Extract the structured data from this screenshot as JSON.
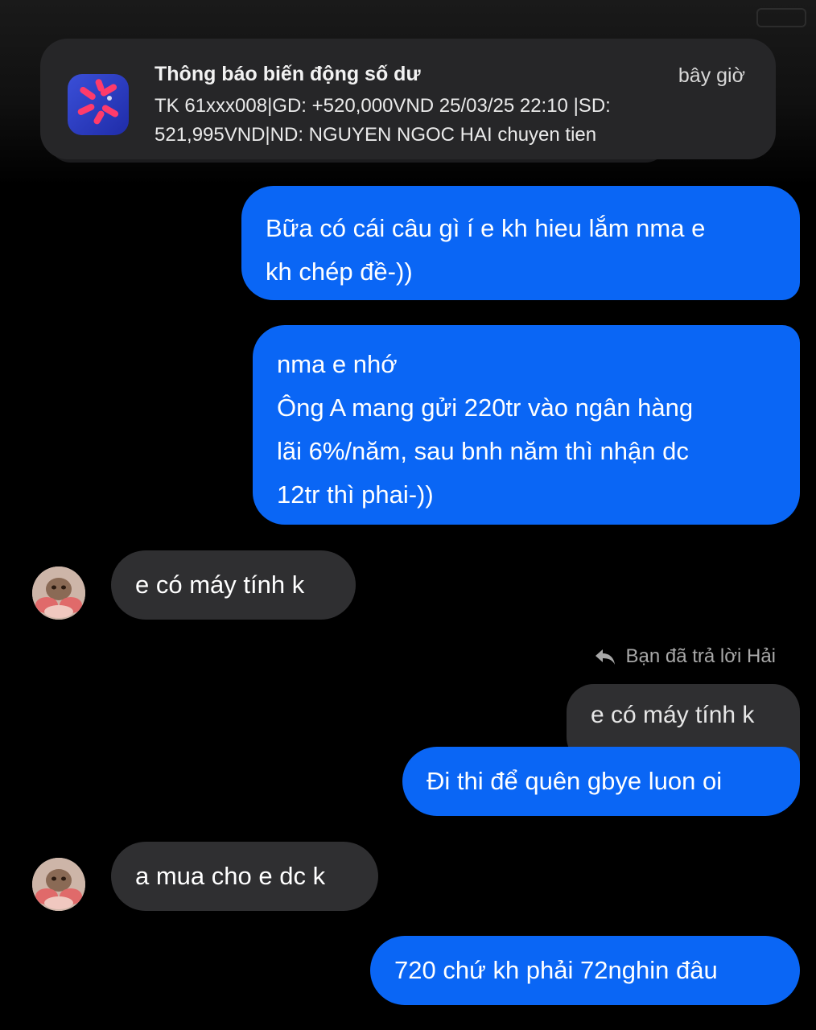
{
  "notification": {
    "title": "Thông báo biến động số dư",
    "time": "bây giờ",
    "body_lines": [
      "TK 61xxx008|GD: +520,000VND 25/03/25 22:10 |SD:",
      "521,995VND|ND: NGUYEN NGOC HAI chuyen tien"
    ],
    "app_icon": "star-molecule-app-icon"
  },
  "messages": [
    {
      "direction": "outgoing",
      "lines": [
        "Bữa có cái câu gì í e kh hieu lắm nma e",
        "kh chép đề-))"
      ]
    },
    {
      "direction": "outgoing",
      "lines": [
        "nma e nhớ",
        "Ông A mang gửi 220tr vào ngân hàng",
        "lãi 6%/năm, sau bnh năm thì nhận dc",
        "12tr thì phai-))"
      ]
    },
    {
      "direction": "incoming",
      "lines": [
        "e có máy tính k"
      ]
    },
    {
      "direction": "reply-quote",
      "reply_label": "Bạn đã trả lời Hải",
      "lines": [
        "e có máy tính k"
      ]
    },
    {
      "direction": "outgoing",
      "lines": [
        "Đi thi để quên gbye luon oi"
      ]
    },
    {
      "direction": "incoming",
      "lines": [
        "a mua cho e dc k"
      ]
    },
    {
      "direction": "outgoing",
      "lines": [
        "720 chứ kh phải 72nghin đâu"
      ]
    }
  ],
  "colors": {
    "outgoing_bubble": "#0a66f5",
    "incoming_bubble": "#2f2f31",
    "background": "#000000",
    "notification_bg": "#262628"
  }
}
